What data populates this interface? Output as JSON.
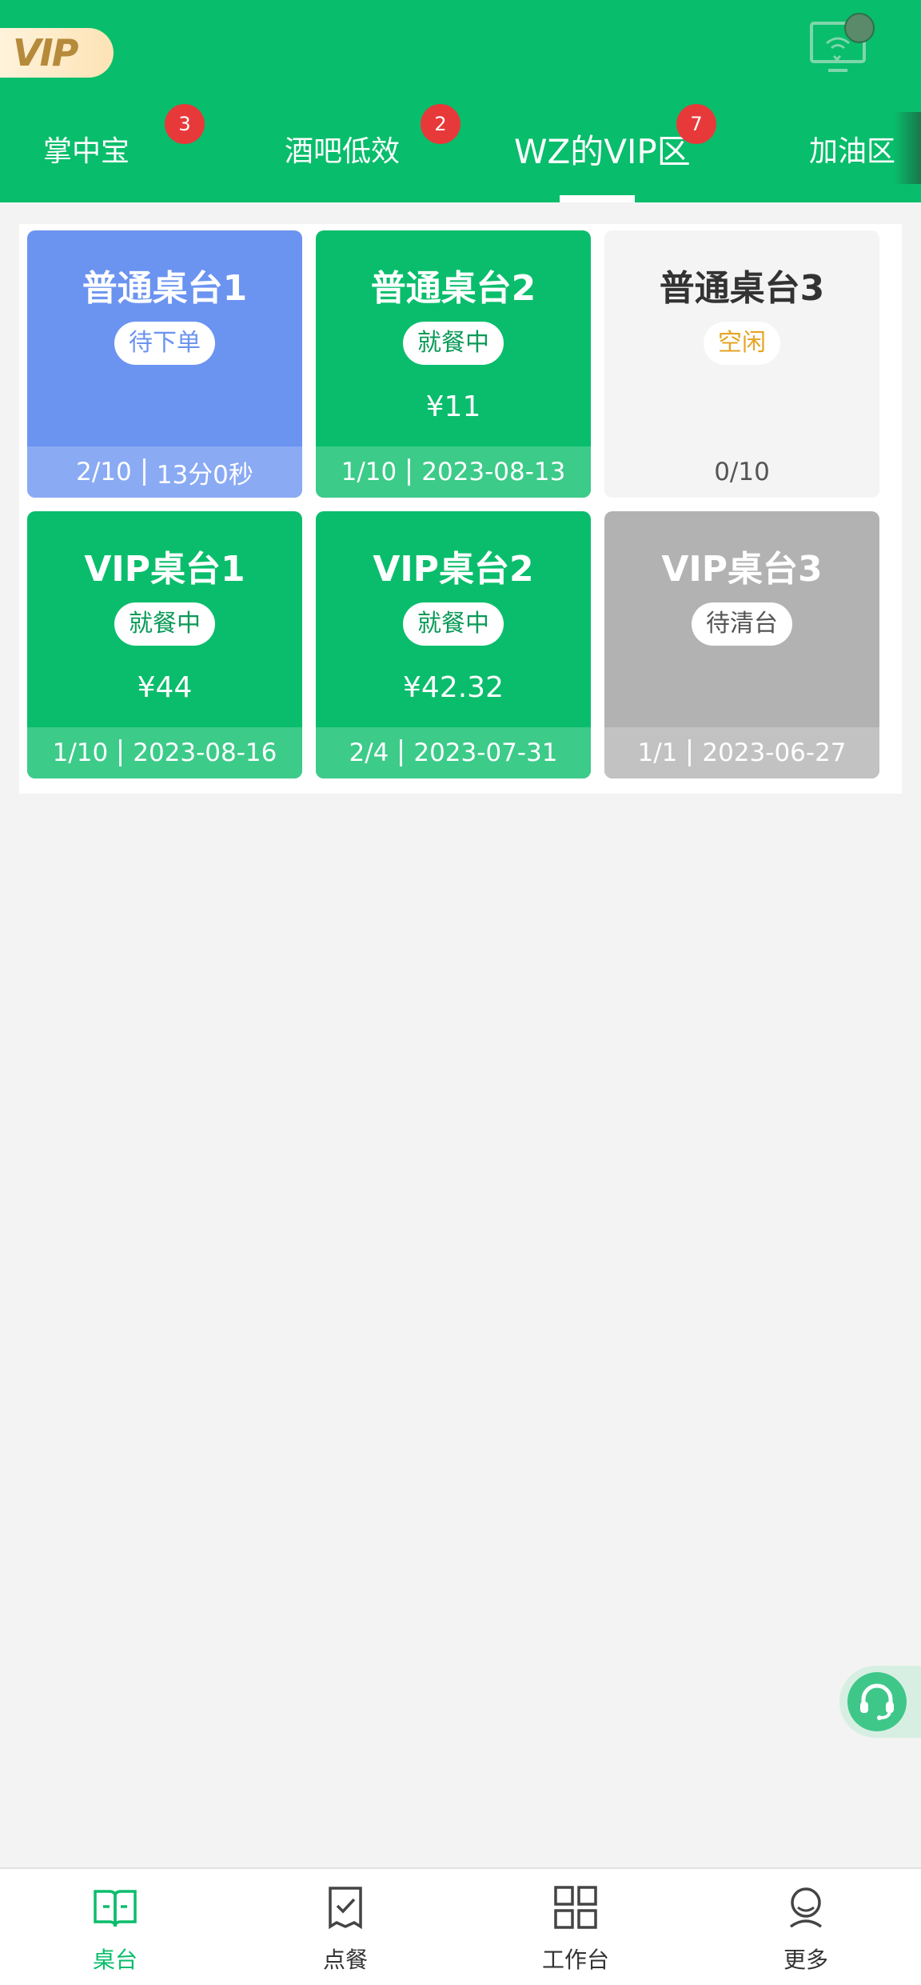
{
  "header": {
    "vip_badge": "VIP",
    "tabs": [
      {
        "label": "掌中宝",
        "badge": "3"
      },
      {
        "label": "酒吧低效",
        "badge": "2"
      },
      {
        "label": "WZ的VIP区",
        "badge": "7"
      },
      {
        "label": "加油区"
      }
    ],
    "active_tab_index": 2
  },
  "tables": [
    {
      "name": "普通桌台1",
      "status": "待下单",
      "amount": "",
      "footer_left": "2/10",
      "footer_right": "13分0秒",
      "state": "ordering"
    },
    {
      "name": "普通桌台2",
      "status": "就餐中",
      "amount": "¥11",
      "footer_left": "1/10",
      "footer_right": "2023-08-13",
      "state": "dining"
    },
    {
      "name": "普通桌台3",
      "status": "空闲",
      "amount": "",
      "footer_left": "0/10",
      "footer_right": "",
      "state": "idle"
    },
    {
      "name": "VIP桌台1",
      "status": "就餐中",
      "amount": "¥44",
      "footer_left": "1/10",
      "footer_right": "2023-08-16",
      "state": "dining"
    },
    {
      "name": "VIP桌台2",
      "status": "就餐中",
      "amount": "¥42.32",
      "footer_left": "2/4",
      "footer_right": "2023-07-31",
      "state": "dining"
    },
    {
      "name": "VIP桌台3",
      "status": "待清台",
      "amount": "",
      "footer_left": "1/1",
      "footer_right": "2023-06-27",
      "state": "to-clean"
    }
  ],
  "bottom_nav": [
    {
      "label": "桌台",
      "icon": "book-open-icon",
      "active": true
    },
    {
      "label": "点餐",
      "icon": "order-check-icon",
      "active": false
    },
    {
      "label": "工作台",
      "icon": "grid-icon",
      "active": false
    },
    {
      "label": "更多",
      "icon": "user-icon",
      "active": false
    }
  ],
  "colors": {
    "brand_green": "#08bd6b",
    "ordering_blue": "#6b93f0",
    "idle_bg": "#f4f4f4",
    "to_clean_gray": "#b2b2b2",
    "badge_red": "#e8393a",
    "idle_status_orange": "#e6a424"
  }
}
